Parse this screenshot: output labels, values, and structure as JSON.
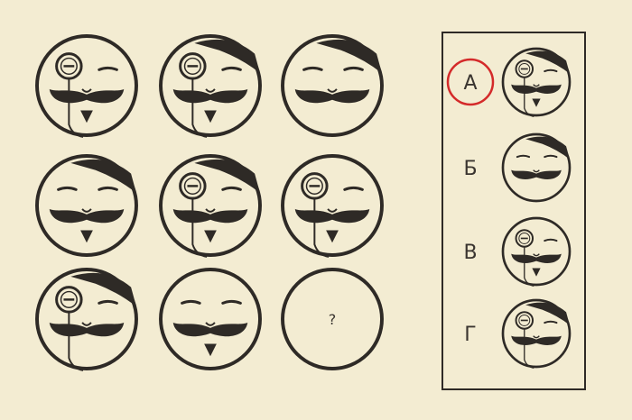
{
  "grid": {
    "cells": [
      {
        "hair": false,
        "monocle": true,
        "goatee": true,
        "question": false
      },
      {
        "hair": true,
        "monocle": true,
        "goatee": true,
        "question": false
      },
      {
        "hair": true,
        "monocle": false,
        "goatee": false,
        "question": false
      },
      {
        "hair": true,
        "monocle": false,
        "goatee": true,
        "question": false
      },
      {
        "hair": true,
        "monocle": true,
        "goatee": true,
        "question": false
      },
      {
        "hair": false,
        "monocle": true,
        "goatee": true,
        "question": false
      },
      {
        "hair": true,
        "monocle": true,
        "goatee": false,
        "question": false
      },
      {
        "hair": false,
        "monocle": false,
        "goatee": true,
        "question": false
      },
      {
        "hair": false,
        "monocle": false,
        "goatee": false,
        "question": true
      }
    ],
    "question_mark": "?"
  },
  "answers": {
    "options": [
      {
        "label": "А",
        "hair": true,
        "monocle": true,
        "goatee": true,
        "circled": true
      },
      {
        "label": "Б",
        "hair": true,
        "monocle": false,
        "goatee": false,
        "circled": false
      },
      {
        "label": "В",
        "hair": false,
        "monocle": true,
        "goatee": true,
        "circled": false
      },
      {
        "label": "Г",
        "hair": true,
        "monocle": true,
        "goatee": false,
        "circled": false
      }
    ]
  },
  "colors": {
    "paper": "#f3ecd2",
    "ink": "#2e2a26",
    "highlight": "#d42a2a"
  }
}
